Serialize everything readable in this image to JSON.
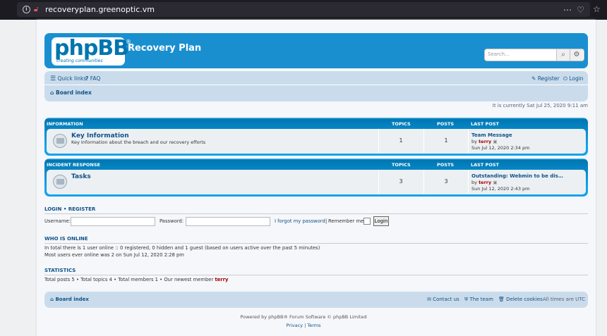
{
  "browser": {
    "url": "recoveryplan.greenoptic.vm",
    "more_icon": "more-icon",
    "pocket_icon": "pocket-icon",
    "star_icon": "star-icon"
  },
  "header": {
    "logo_text": "phpBB",
    "logo_sub": "creating communities",
    "logo_reg": "®",
    "site_title": "Recovery Plan",
    "search_placeholder": "Search…"
  },
  "nav": {
    "quick_links": "Quick links",
    "faq": "FAQ",
    "register": "Register",
    "login": "Login",
    "board_index": "Board index"
  },
  "current_time": "It is currently Sat Jul 25, 2020 9:11 am",
  "categories": [
    {
      "name": "INFORMATION",
      "col_topics": "TOPICS",
      "col_posts": "POSTS",
      "col_last": "LAST POST",
      "forum": {
        "title": "Key Information",
        "desc": "Key Information about the breach and our recovery efforts",
        "topics": "1",
        "posts": "1",
        "last_title": "Team Message",
        "last_by": "by",
        "last_user": "terry",
        "last_date": "Sun Jul 12, 2020 2:34 pm"
      }
    },
    {
      "name": "INCIDENT RESPONSE",
      "col_topics": "TOPICS",
      "col_posts": "POSTS",
      "col_last": "LAST POST",
      "forum": {
        "title": "Tasks",
        "desc": "",
        "topics": "3",
        "posts": "3",
        "last_title": "Outstanding: Webmin to be dis…",
        "last_by": "by",
        "last_user": "terry",
        "last_date": "Sun Jul 12, 2020 2:43 pm"
      }
    }
  ],
  "login": {
    "heading_login": "LOGIN",
    "sep": "•",
    "heading_register": "REGISTER",
    "username_label": "Username:",
    "password_label": "Password:",
    "forgot": "I forgot my password",
    "pipe": "|",
    "remember": "Remember me",
    "button": "Login"
  },
  "online": {
    "heading": "WHO IS ONLINE",
    "line1": "In total there is 1 user online :: 0 registered, 0 hidden and 1 guest (based on users active over the past 5 minutes)",
    "line2": "Most users ever online was 2 on Sun Jul 12, 2020 2:28 pm"
  },
  "stats": {
    "heading": "STATISTICS",
    "line_prefix": "Total posts 5 • Total topics 4 • Total members 1 • Our newest member",
    "newest": "terry"
  },
  "footer": {
    "board_index": "Board index",
    "contact": "Contact us",
    "team": "The team",
    "cookies": "Delete cookies",
    "tz": "All times are UTC",
    "powered": "Powered by phpBB® Forum Software © phpBB Limited",
    "privacy": "Privacy",
    "sep": "|",
    "terms": "Terms"
  }
}
